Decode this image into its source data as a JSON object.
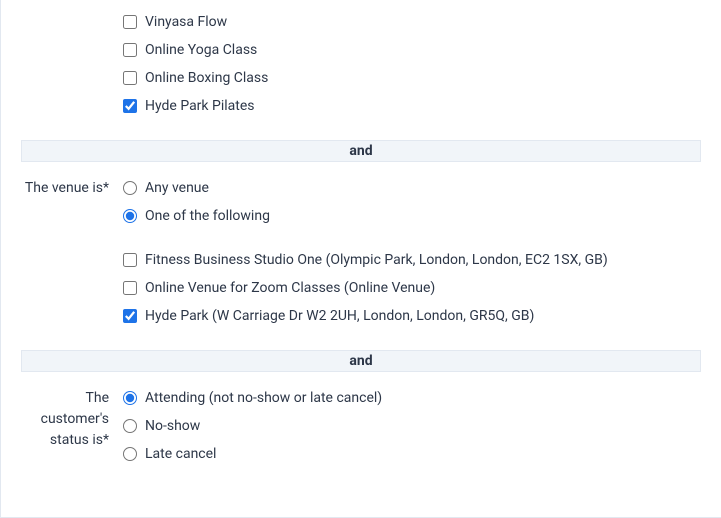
{
  "separator_label": "and",
  "class_section": {
    "label": "",
    "options": [
      {
        "label": "Vinyasa Flow",
        "checked": false
      },
      {
        "label": "Online Yoga Class",
        "checked": false
      },
      {
        "label": "Online Boxing Class",
        "checked": false
      },
      {
        "label": "Hyde Park Pilates",
        "checked": true
      }
    ]
  },
  "venue_section": {
    "label": "The venue is*",
    "radio": [
      {
        "label": "Any venue",
        "selected": false
      },
      {
        "label": "One of the following",
        "selected": true
      }
    ],
    "options": [
      {
        "label": "Fitness Business Studio One (Olympic Park, London, London, EC2 1SX, GB)",
        "checked": false
      },
      {
        "label": "Online Venue for Zoom Classes (Online Venue)",
        "checked": false
      },
      {
        "label": "Hyde Park (W Carriage Dr W2 2UH, London, London, GR5Q, GB)",
        "checked": true
      }
    ]
  },
  "status_section": {
    "label": "The customer's status is*",
    "radio": [
      {
        "label": "Attending (not no-show or late cancel)",
        "selected": true
      },
      {
        "label": "No-show",
        "selected": false
      },
      {
        "label": "Late cancel",
        "selected": false
      }
    ]
  }
}
